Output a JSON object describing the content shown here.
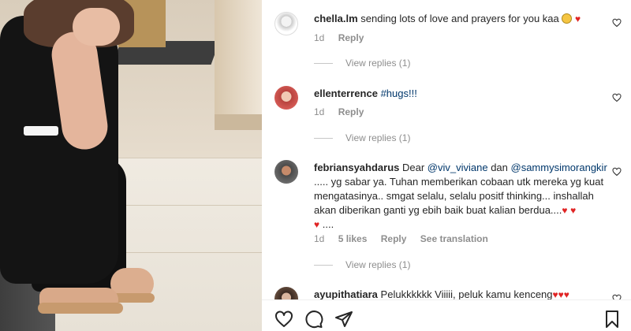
{
  "comments": [
    {
      "username": "chella.lm",
      "text": "sending lots of love and prayers for you kaa",
      "time": "1d",
      "reply_label": "Reply",
      "view_replies": "View replies (1)"
    },
    {
      "username": "ellenterrence",
      "text": "#hugs!!!",
      "time": "1d",
      "reply_label": "Reply",
      "view_replies": "View replies (1)"
    },
    {
      "username": "febriansyahdarus",
      "text_pre": "Dear ",
      "mention1": "@viv_viviane",
      "text_mid": " dan ",
      "mention2": "@sammysimorangkir",
      "text_post": " ..... yg sabar ya. Tuhan memberikan cobaan utk mereka yg kuat mengatasinya.. smgat selalu, selalu positf thinking... inshallah akan diberikan ganti yg ebih baik buat kalian berdua....",
      "text_end": "....",
      "time": "1d",
      "likes": "5 likes",
      "reply_label": "Reply",
      "translation": "See translation",
      "view_replies": "View replies (1)"
    },
    {
      "username": "ayupithatiara",
      "text": "Pelukkkkkk Viiiii, peluk kamu kenceng"
    }
  ],
  "icons": {
    "like": "heart-outline-icon",
    "comment": "comment-bubble-icon",
    "share": "paper-plane-icon",
    "save": "bookmark-icon"
  },
  "colors": {
    "mention": "#00376b",
    "heart": "#e02424",
    "meta": "#8e8e8e"
  }
}
